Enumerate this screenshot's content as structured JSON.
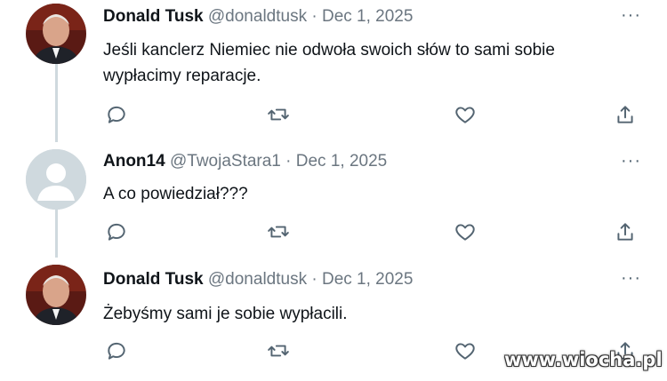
{
  "tweets": [
    {
      "name": "Donald Tusk",
      "handle": "@donaldtusk",
      "date": "Dec 1, 2025",
      "text_lines": [
        "Jeśli kanclerz Niemiec nie odwoła swoich słów to sami sobie",
        "wypłacimy reparacje."
      ],
      "avatar": "photo-avatar"
    },
    {
      "name": "Anon14",
      "handle": "@TwojaStara1",
      "date": "Dec 1, 2025",
      "text_lines": [
        "A co powiedział???"
      ],
      "avatar": "default-avatar"
    },
    {
      "name": "Donald Tusk",
      "handle": "@donaldtusk",
      "date": "Dec 1, 2025",
      "text_lines": [
        "Żebyśmy sami je sobie wypłacili."
      ],
      "avatar": "photo-avatar"
    }
  ],
  "separator": "·",
  "more_label": "···",
  "icons": {
    "reply": "reply-icon",
    "retweet": "retweet-icon",
    "like": "like-icon",
    "share": "share-icon"
  },
  "colors": {
    "icon": "#536471",
    "meta": "#6b7680",
    "thread_line": "#cfd9de",
    "default_avatar_bg": "#cfd9de"
  },
  "watermark": "www.wiocha.pl"
}
